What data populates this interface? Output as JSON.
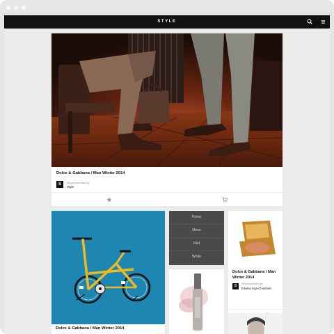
{
  "app": {
    "brand": "STYLE"
  },
  "icons": {
    "search": "search-icon",
    "menu": "hamburger-menu-icon",
    "favorite": "star-icon",
    "cart": "cart-icon"
  },
  "hero": {
    "title": "Dolce & Gabbana / Man Winter 2014",
    "recommended_label": "Recommended by",
    "recommender": "Style",
    "badge": "S"
  },
  "nav_menu": {
    "items": [
      "Home",
      "Mens",
      "Red",
      "White"
    ]
  },
  "compact_card": {
    "title": "Dolce & Gabbana / Man Winter 2014",
    "recommended_label": "Recommended by",
    "recommender": "Edwina Ings-Chambers",
    "badge": "S"
  },
  "bike_card": {
    "title": "Dolce & Gabbana / Man Winter 2014"
  },
  "colors": {
    "topbar": "#111111",
    "bike_background": "#1d87b2",
    "bike_frame": "#f2b81f",
    "menu_background": "#4a4a4a"
  }
}
